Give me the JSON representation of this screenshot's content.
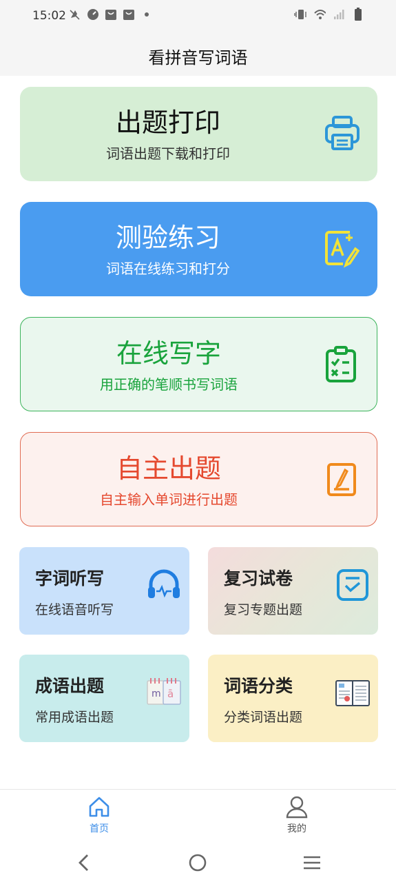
{
  "status_bar": {
    "time": "15:02"
  },
  "title_bar": {
    "title": "看拼音写词语"
  },
  "cards": {
    "print": {
      "title": "出题打印",
      "subtitle": "词语出题下载和打印"
    },
    "test": {
      "title": "测验练习",
      "subtitle": "词语在线练习和打分"
    },
    "write": {
      "title": "在线写字",
      "subtitle": "用正确的笔顺书写词语"
    },
    "custom": {
      "title": "自主出题",
      "subtitle": "自主输入单词进行出题"
    }
  },
  "small_cards": {
    "dictation": {
      "title": "字词听写",
      "subtitle": "在线语音听写"
    },
    "review": {
      "title": "复习试卷",
      "subtitle": "复习专题出题"
    },
    "idiom": {
      "title": "成语出题",
      "subtitle": "常用成语出题"
    },
    "category": {
      "title": "词语分类",
      "subtitle": "分类词语出题"
    }
  },
  "bottom_nav": {
    "home_label": "首页",
    "mine_label": "我的"
  },
  "icons": {
    "print": "printer-icon",
    "test": "edit-a-icon",
    "write": "clipboard-check-icon",
    "custom": "note-edit-icon",
    "dictation": "headphones-icon",
    "review": "checkbox-icon",
    "idiom": "calendar-pinyin-icon",
    "category": "notebook-icon"
  },
  "colors": {
    "print_bg": "#d6eed5",
    "test_bg": "#4a9cf0",
    "write_accent": "#19a33c",
    "custom_accent": "#e5492f",
    "nav_active": "#3d8ee8"
  }
}
